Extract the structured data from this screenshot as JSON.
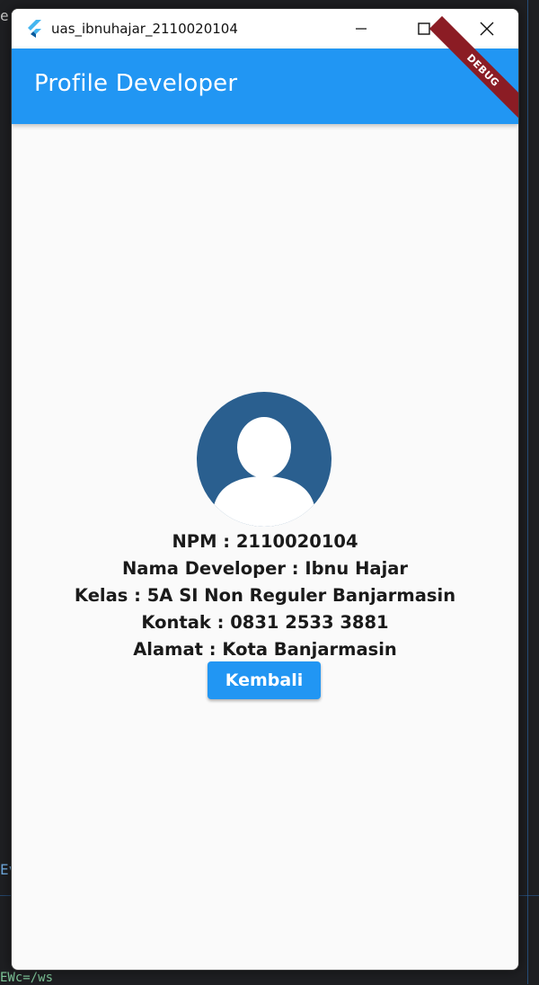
{
  "window": {
    "title": "uas_ibnuhajar_2110020104"
  },
  "appbar": {
    "title": "Profile Developer",
    "debug_label": "DEBUG"
  },
  "profile": {
    "npm": "NPM : 2110020104",
    "nama": "Nama Developer : Ibnu Hajar",
    "kelas": "Kelas : 5A SI Non Reguler Banjarmasin",
    "kontak": "Kontak : 0831 2533 3881",
    "alamat": "Alamat : Kota Banjarmasin"
  },
  "button": {
    "label": "Kembali"
  },
  "background": {
    "fragment_top_left": "er.",
    "fragment_mid_left": "Ev",
    "fragment_bottom_left": "EWc=/ws"
  },
  "colors": {
    "accent": "#2196f3",
    "avatar": "#2a5f8f",
    "debug_banner": "#8b1c24",
    "surface": "#fafafa"
  },
  "icons": {
    "app": "flutter-logo-icon",
    "minimize": "minimize-icon",
    "maximize": "maximize-icon",
    "close": "close-icon",
    "avatar": "person-icon"
  }
}
